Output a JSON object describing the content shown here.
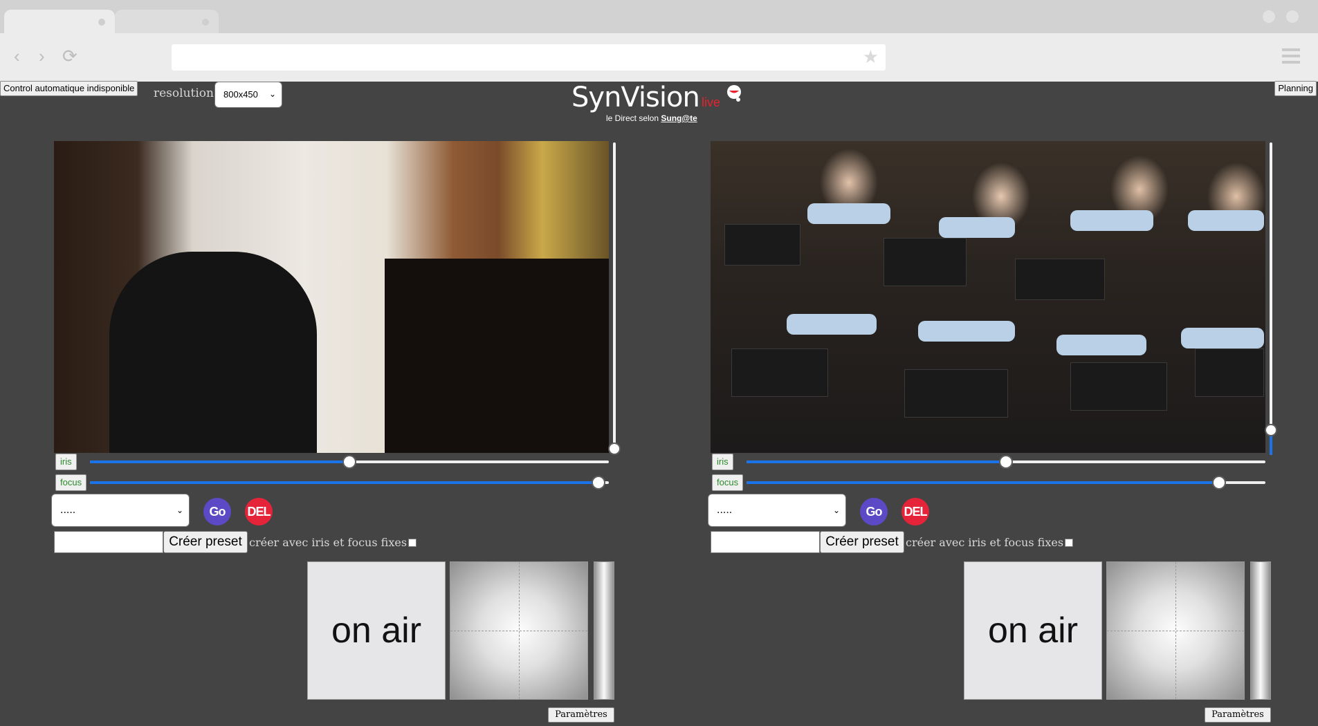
{
  "header": {
    "control_status": "Control automatique indisponible",
    "resolution_label": "resolution",
    "resolution_value": "800x450",
    "planning_label": "Planning",
    "logo_main": "SynVision",
    "logo_live": "live",
    "logo_sub_prefix": "le Direct selon ",
    "logo_sub_brand": "Sung@te"
  },
  "icons": {
    "back": "‹",
    "forward": "›",
    "reload": "⟳",
    "bookmark": "★",
    "caret": "⌄"
  },
  "cameras": [
    {
      "iris_label": "iris",
      "iris_value": 50,
      "focus_label": "focus",
      "focus_value": 98,
      "zoom_value": 2,
      "preset_value": ".....",
      "go_label": "Go",
      "del_label": "DEL",
      "create_label": "Créer preset",
      "fixed_label": "créer avec iris et focus fixes",
      "onair_label": "on air",
      "params_label": "Paramètres"
    },
    {
      "iris_label": "iris",
      "iris_value": 50,
      "focus_label": "focus",
      "focus_value": 91,
      "zoom_value": 8,
      "preset_value": ".....",
      "go_label": "Go",
      "del_label": "DEL",
      "create_label": "Créer preset",
      "fixed_label": "créer avec iris et focus fixes",
      "onair_label": "on air",
      "params_label": "Paramètres"
    }
  ],
  "colors": {
    "background": "#444444",
    "slider_blue": "#1a73e8",
    "go": "#5b49c5",
    "del": "#e5243a",
    "live_red": "#e8222e"
  }
}
